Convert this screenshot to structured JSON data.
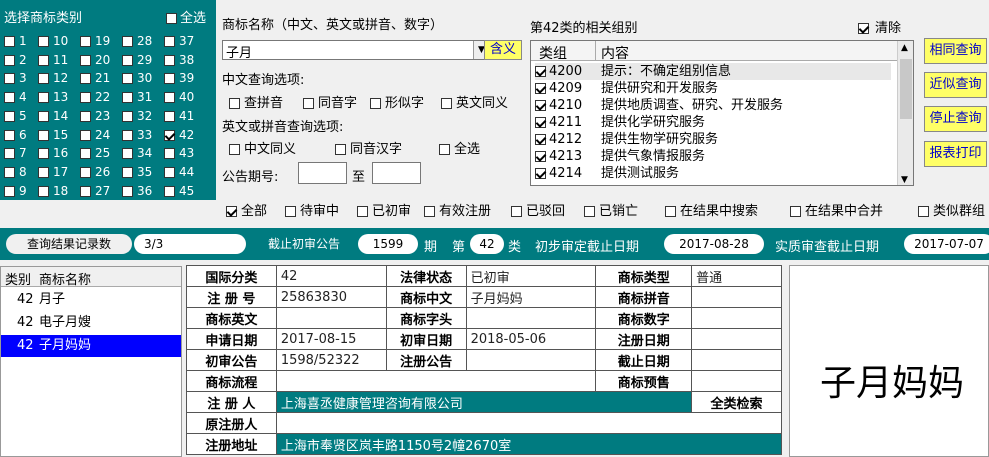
{
  "category_panel": {
    "title": "选择商标类别",
    "select_all": "全选",
    "columns": [
      [
        "1",
        "2",
        "3",
        "4",
        "5",
        "6",
        "7",
        "8",
        "9"
      ],
      [
        "10",
        "11",
        "12",
        "13",
        "14",
        "15",
        "16",
        "17",
        "18"
      ],
      [
        "19",
        "20",
        "21",
        "22",
        "23",
        "24",
        "25",
        "26",
        "27"
      ],
      [
        "28",
        "29",
        "30",
        "31",
        "32",
        "33",
        "34",
        "35",
        "36"
      ],
      [
        "37",
        "38",
        "39",
        "40",
        "41",
        "42",
        "43",
        "44",
        "45"
      ]
    ],
    "checked": "42"
  },
  "search": {
    "name_label": "商标名称（中文、英文或拼音、数字）",
    "name_value": "子月",
    "meaning_button": "含义",
    "cn_options_label": "中文查询选项:",
    "cn_options": [
      "查拼音",
      "同音字",
      "形似字",
      "英文同义"
    ],
    "en_options_label": "英文或拼音查询选项:",
    "en_options": [
      "中文同义",
      "同音汉字",
      "全选"
    ],
    "issue_label": "公告期号:",
    "issue_to": "至"
  },
  "groups": {
    "title": "第42类的相关组别",
    "clear": "清除",
    "col_group": "类组",
    "col_content": "内容",
    "rows": [
      {
        "code": "4200",
        "text": "提示：不确定组别信息"
      },
      {
        "code": "4209",
        "text": "提供研究和开发服务"
      },
      {
        "code": "4210",
        "text": "提供地质调查、研究、开发服务"
      },
      {
        "code": "4211",
        "text": "提供化学研究服务"
      },
      {
        "code": "4212",
        "text": "提供生物学研究服务"
      },
      {
        "code": "4213",
        "text": "提供气象情报服务"
      },
      {
        "code": "4214",
        "text": "提供测试服务"
      }
    ]
  },
  "actions": {
    "same": "相同查询",
    "similar": "近似查询",
    "stop": "停止查询",
    "print": "报表打印"
  },
  "filters": [
    "全部",
    "待审中",
    "已初审",
    "有效注册",
    "已驳回",
    "已销亡",
    "在结果中搜索",
    "在结果中合并",
    "类似群组"
  ],
  "status_bar": {
    "records_label": "查询结果记录数",
    "records_value": "3/3",
    "cutoff_label": "截止初审公告",
    "cutoff_value": "1599",
    "cutoff_unit": "期",
    "class_prefix": "第",
    "class_value": "42",
    "class_suffix": "类",
    "prelim_label": "初步审定截止日期",
    "prelim_value": "2017-08-28",
    "exam_label": "实质审查截止日期",
    "exam_value": "2017-07-07"
  },
  "results": {
    "col_class": "类别",
    "col_name": "商标名称",
    "rows": [
      {
        "class": "42",
        "name": "月子"
      },
      {
        "class": "42",
        "name": "电子月嫂"
      },
      {
        "class": "42",
        "name": "子月妈妈"
      }
    ],
    "selected": 2
  },
  "detail": {
    "intl_class_label": "国际分类",
    "intl_class": "42",
    "legal_label": "法律状态",
    "legal": "已初审",
    "type_label": "商标类型",
    "type": "普通",
    "reg_no_label": "注 册 号",
    "reg_no": "25863830",
    "cn_label": "商标中文",
    "cn": "子月妈妈",
    "pinyin_label": "商标拼音",
    "pinyin": "",
    "en_label": "商标英文",
    "en": "",
    "initial_label": "商标字头",
    "initial": "",
    "digit_label": "商标数字",
    "digit": "",
    "apply_label": "申请日期",
    "apply": "2017-08-15",
    "prelim_label": "初审日期",
    "prelim": "2018-05-06",
    "regdate_label": "注册日期",
    "regdate": "",
    "prelim_ann_label": "初审公告",
    "prelim_ann": "1598/52322",
    "reg_ann_label": "注册公告",
    "reg_ann": "",
    "expire_label": "截止日期",
    "expire": "",
    "flow_label": "商标流程",
    "flow": "",
    "alert_label": "商标预售",
    "alert": "",
    "registrant_label": "注 册 人",
    "registrant": "上海喜丞健康管理咨询有限公司",
    "all_search": "全类检索",
    "orig_label": "原注册人",
    "orig": "",
    "addr_label": "注册地址",
    "addr": "上海市奉贤区岚丰路1150号2幢2670室"
  },
  "preview": {
    "text": "子月妈妈"
  }
}
